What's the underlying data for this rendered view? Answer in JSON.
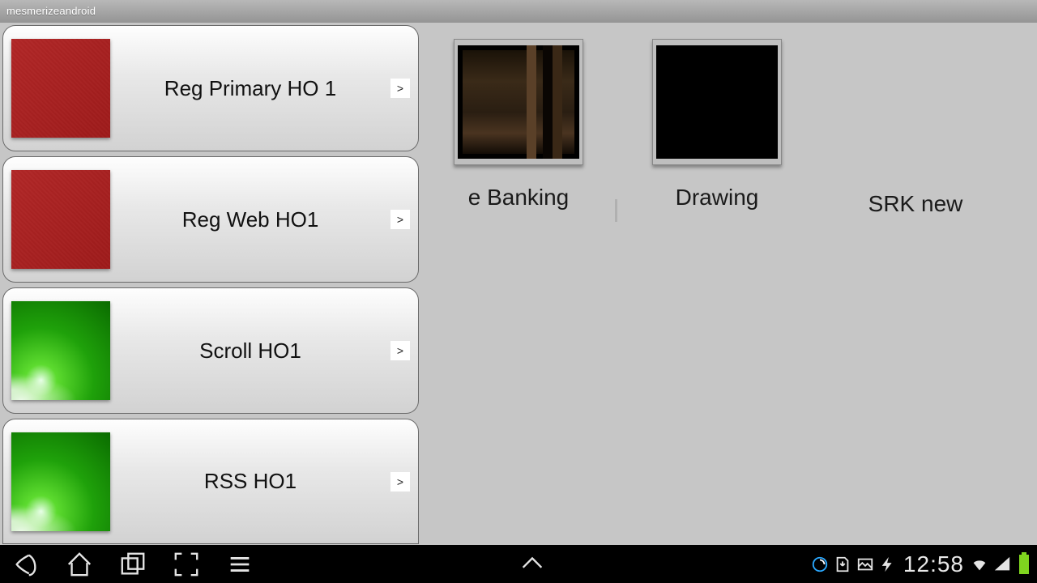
{
  "titlebar": {
    "text": "mesmerizeandroid"
  },
  "sidebar": {
    "items": [
      {
        "label": "Reg Primary HO 1",
        "chevron": ">",
        "thumb": "red"
      },
      {
        "label": "Reg Web HO1",
        "chevron": ">",
        "thumb": "red"
      },
      {
        "label": "Scroll HO1",
        "chevron": ">",
        "thumb": "green"
      },
      {
        "label": "RSS HO1",
        "chevron": ">",
        "thumb": "green"
      }
    ]
  },
  "grid": {
    "items": [
      {
        "label": "e Banking",
        "thumb": "photo"
      },
      {
        "label": "Drawing",
        "thumb": "black"
      },
      {
        "label": "SRK new",
        "thumb": "none"
      }
    ]
  },
  "statusbar": {
    "time": "12:58"
  }
}
